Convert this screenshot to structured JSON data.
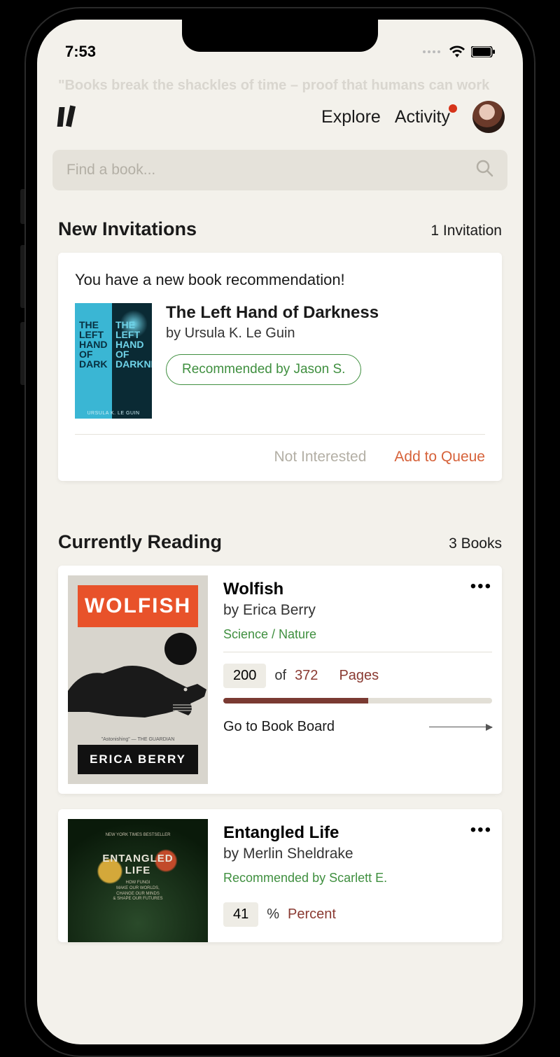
{
  "status": {
    "time": "7:53"
  },
  "quote": "\"Books break the shackles of time – proof that humans can work magic.\" – Carl Sagan",
  "header": {
    "nav": {
      "explore": "Explore",
      "activity": "Activity"
    }
  },
  "search": {
    "placeholder": "Find a book..."
  },
  "invitations": {
    "heading": "New Invitations",
    "count_label": "1 Invitation",
    "message": "You have a new book recommendation!",
    "book": {
      "title": "The Left Hand of Darkness",
      "author_line": "by Ursula K. Le Guin",
      "cover_left": "THE\nLEFT\nHAND\nOF\nDARK",
      "cover_right": "THE\nLEFT\nHAND\nOF\nDARKNESS",
      "cover_author": "URSULA K. LE GUIN"
    },
    "recommended_by": "Recommended by Jason S.",
    "actions": {
      "not_interested": "Not Interested",
      "add_queue": "Add to Queue"
    }
  },
  "reading": {
    "heading": "Currently Reading",
    "count_label": "3 Books",
    "books": [
      {
        "title": "Wolfish",
        "author_line": "by Erica Berry",
        "genre": "Science / Nature",
        "cover_title": "WOLFISH",
        "cover_author": "ERICA BERRY",
        "progress": {
          "current": "200",
          "of": "of",
          "total": "372",
          "unit": "Pages",
          "percent": 54
        },
        "board_link": "Go to Book Board"
      },
      {
        "title": "Entangled Life",
        "author_line": "by Merlin Sheldrake",
        "recommended_by": "Recommended by Scarlett E.",
        "cover_title": "ENTANGLED\nLIFE",
        "cover_sub": "HOW FUNGI\nMAKE OUR WORLDS,\nCHANGE OUR MINDS\n& SHAPE OUR FUTURES",
        "cover_bestseller": "NEW YORK TIMES BESTSELLER",
        "progress": {
          "current": "41",
          "symbol": "%",
          "unit": "Percent",
          "percent": 41
        }
      }
    ]
  }
}
